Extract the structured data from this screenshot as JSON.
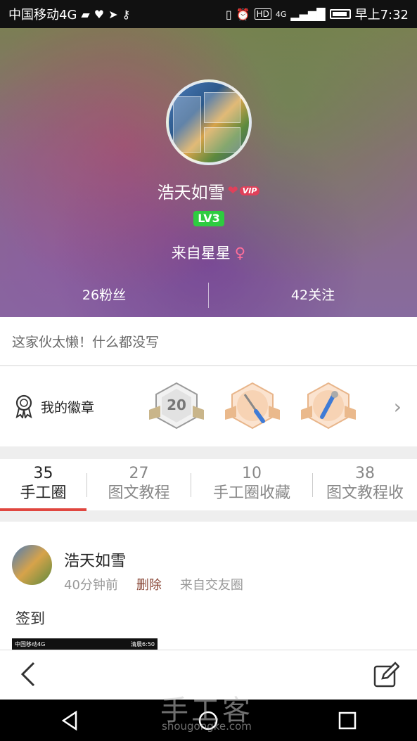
{
  "status_bar": {
    "carrier": "中国移动4G",
    "hd": "HD",
    "network": "4G",
    "time": "早上7:32"
  },
  "profile": {
    "username": "浩天如雪",
    "vip_label": "VIP",
    "level": "LV3",
    "location": "来自星星",
    "fans": "26粉丝",
    "following": "42关注"
  },
  "bio": "这家伙太懒！什么都没写",
  "badges": {
    "title": "我的徽章",
    "items": [
      "20"
    ]
  },
  "tabs": [
    {
      "count": "35",
      "label": "手工圈"
    },
    {
      "count": "27",
      "label": "图文教程"
    },
    {
      "count": "10",
      "label": "手工圈收藏"
    },
    {
      "count": "38",
      "label": "图文教程收"
    }
  ],
  "post": {
    "author": "浩天如雪",
    "time_ago": "40分钟前",
    "delete_label": "删除",
    "source": "来自交友圈",
    "text": "签到",
    "thumb_carrier": "中国移动4G",
    "thumb_time": "清晨6:50"
  },
  "watermark": {
    "text": "手工客",
    "url": "shougongke.com"
  },
  "colors": {
    "accent": "#e0463f",
    "level_green": "#2ecc40",
    "vip_pink": "#e0405a"
  }
}
